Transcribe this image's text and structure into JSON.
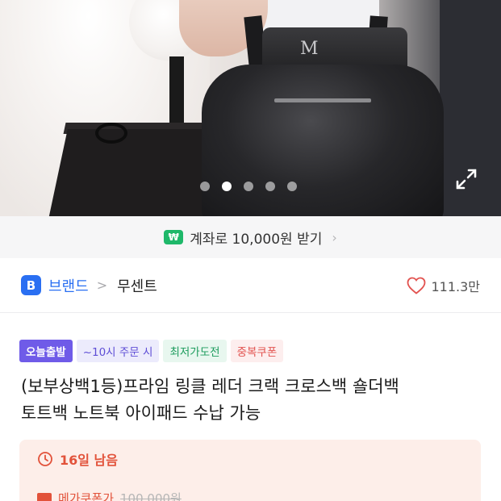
{
  "product_image": {
    "monogram": "M",
    "carousel": {
      "total": 5,
      "active_index": 2
    },
    "expand_icon": "expand-icon"
  },
  "banner": {
    "badge": "₩",
    "text": "계좌로 10,000원 받기",
    "chevron": "›",
    "accent_color": "#1fb86a"
  },
  "brand": {
    "badge": "B",
    "label": "브랜드",
    "separator": ">",
    "name": "무센트",
    "likes": "111.3만",
    "brand_color": "#2a6ff2"
  },
  "tags": [
    {
      "label": "오늘출발",
      "color": "#6f5be8"
    },
    {
      "label": "~10시 주문 시",
      "color": "#5e4ed6"
    },
    {
      "label": "최저가도전",
      "color": "#1d9c5d"
    },
    {
      "label": "중복쿠폰",
      "color": "#e2524f"
    }
  ],
  "title": {
    "line1": "(보부상백1등)프라임 링클 레더 크랙 크로스백 숄더백",
    "line2": "토트백 노트북 아이패드 수납 가능"
  },
  "deal": {
    "time_left": "16일 남음",
    "coupon_label": "메가쿠폰가",
    "coupon_price": "100,000원",
    "accent_color": "#e2523a"
  }
}
